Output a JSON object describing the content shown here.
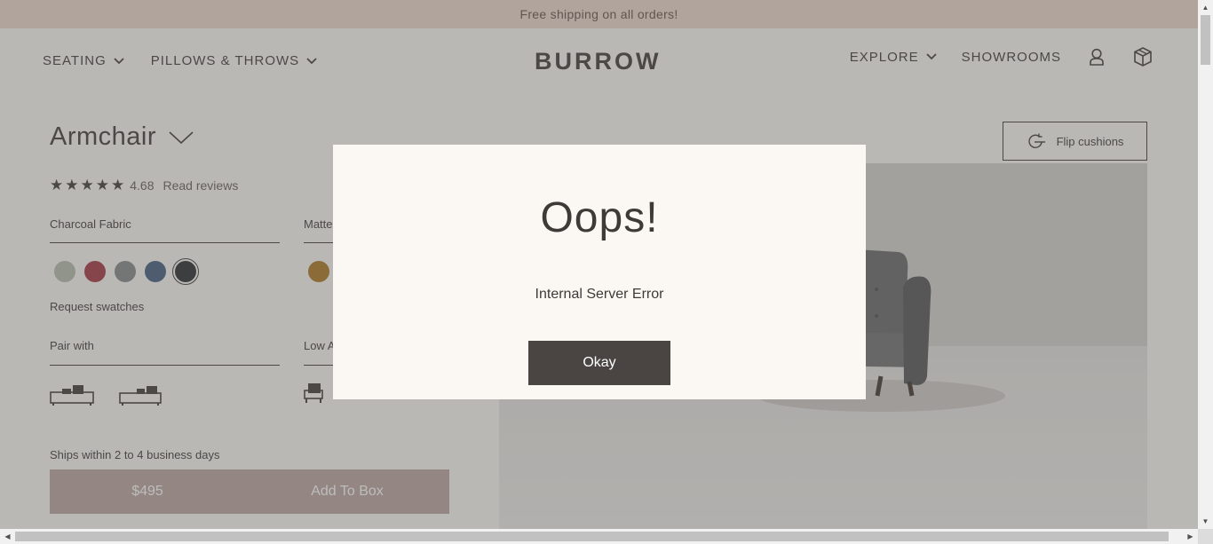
{
  "banner": {
    "text": "Free shipping on all orders!"
  },
  "header": {
    "nav_left": [
      {
        "label": "SEATING"
      },
      {
        "label": "PILLOWS & THROWS"
      }
    ],
    "logo": "BURROW",
    "nav_right": [
      {
        "label": "EXPLORE"
      },
      {
        "label": "SHOWROOMS"
      }
    ]
  },
  "product": {
    "title": "Armchair",
    "rating": "4.68",
    "reviews_link": "Read reviews",
    "fabric_label": "Charcoal Fabric",
    "finish_label": "Matte",
    "request_swatches": "Request swatches",
    "pair_with_label": "Pair with",
    "low_arm_label": "Low A",
    "ships_text": "Ships within 2 to 4 business days",
    "price": "$495",
    "add_to_box": "Add To Box",
    "flip_cushions": "Flip cushions"
  },
  "swatches": {
    "fabric": [
      "#b8bfae",
      "#a8404a",
      "#8b8e8f",
      "#4c6783",
      "#333436"
    ],
    "finish": [
      "#b07f2c"
    ]
  },
  "modal": {
    "title": "Oops!",
    "message": "Internal Server Error",
    "button": "Okay"
  }
}
